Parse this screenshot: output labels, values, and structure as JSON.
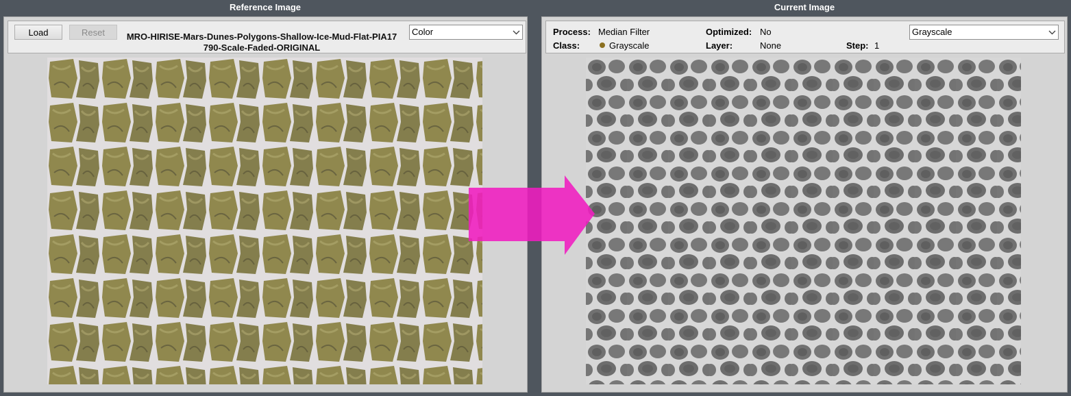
{
  "left_panel": {
    "title": "Reference Image",
    "load_label": "Load",
    "reset_label": "Reset",
    "file_name_line1": "MRO-HIRISE-Mars-Dunes-Polygons-Shallow-Ice-Mud-Flat-PIA17",
    "file_name_line2": "790-Scale-Faded-ORIGINAL",
    "color_mode": "Color"
  },
  "right_panel": {
    "title": "Current Image",
    "process_label": "Process:",
    "process_value": "Median Filter",
    "class_label": "Class:",
    "class_value": "Grayscale",
    "optimized_label": "Optimized:",
    "optimized_value": "No",
    "layer_label": "Layer:",
    "layer_value": "None",
    "step_label": "Step:",
    "step_value": "1",
    "color_mode": "Grayscale"
  },
  "colors": {
    "background": "#4f565e",
    "panel": "#d4d4d4",
    "arrow": "#f01cc0",
    "class_dot": "#8b7020"
  },
  "icons": [
    "chevron-down-icon",
    "right-arrow-icon",
    "dot-icon"
  ]
}
